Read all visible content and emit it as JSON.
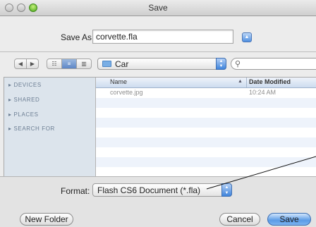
{
  "window": {
    "title": "Save"
  },
  "save_as": {
    "label": "Save As:",
    "value": "corvette.fla"
  },
  "location": {
    "folder": "Car"
  },
  "sidebar": {
    "sections": [
      "DEVICES",
      "SHARED",
      "PLACES",
      "SEARCH FOR"
    ]
  },
  "file_list": {
    "columns": [
      "Name",
      "Date Modified"
    ],
    "rows": [
      {
        "name": "corvette.jpg",
        "date": "10:24 AM"
      }
    ]
  },
  "format": {
    "label": "Format:",
    "value": "Flash CS6 Document (*.fla)"
  },
  "buttons": {
    "new_folder": "New Folder",
    "cancel": "Cancel",
    "save": "Save"
  },
  "icons": {
    "back": "◀",
    "forward": "▶",
    "view_icon": "☷",
    "view_list": "≡",
    "view_column": "▥",
    "search": "⚲",
    "expand": "▲",
    "sort": "▲",
    "popup_up": "▲",
    "popup_down": "▼"
  },
  "colors": {
    "accent": "#4f8fe0",
    "sidebar_bg": "#dce4ec",
    "sidebar_text": "#6c7e93"
  }
}
